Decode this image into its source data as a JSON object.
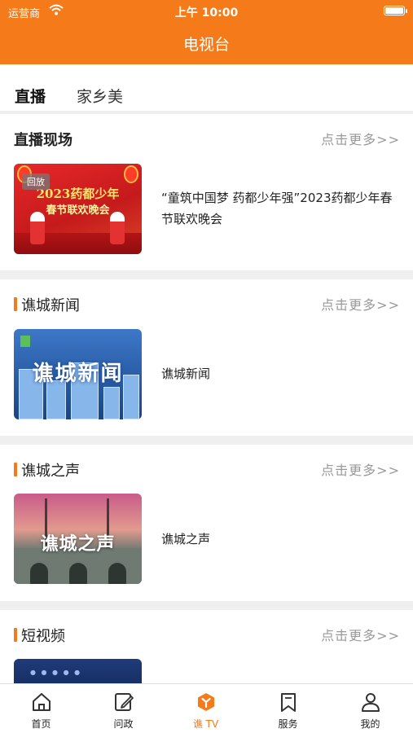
{
  "status_bar": {
    "carrier": "运营商",
    "time": "上午 10:00"
  },
  "header": {
    "title": "电视台"
  },
  "tabs": [
    {
      "label": "直播",
      "active": true
    },
    {
      "label": "家乡美",
      "active": false
    }
  ],
  "sections": [
    {
      "title": "直播现场",
      "more": "点击更多>>",
      "item": {
        "text": "“童筑中国梦 药都少年强”2023药都少年春节联欢晚会",
        "badge": "回放",
        "thumb_title": "2023药都少年",
        "thumb_subtitle": "春节联欢晚会"
      }
    },
    {
      "title": "谯城新闻",
      "more": "点击更多>>",
      "item": {
        "text": "谯城新闻",
        "thumb_title": "谯城新闻"
      }
    },
    {
      "title": "谯城之声",
      "more": "点击更多>>",
      "item": {
        "text": "谯城之声",
        "thumb_title": "谯城之声"
      }
    },
    {
      "title": "短视频",
      "more": "点击更多>>"
    }
  ],
  "tabbar": [
    {
      "label": "首页",
      "icon": "home-icon",
      "active": false
    },
    {
      "label": "问政",
      "icon": "edit-icon",
      "active": false
    },
    {
      "label": "谯 TV",
      "icon": "tv-hexagon-icon",
      "active": true
    },
    {
      "label": "服务",
      "icon": "bookmark-icon",
      "active": false
    },
    {
      "label": "我的",
      "icon": "user-icon",
      "active": false
    }
  ],
  "colors": {
    "accent": "#f57a1a",
    "more_text": "#999999"
  }
}
